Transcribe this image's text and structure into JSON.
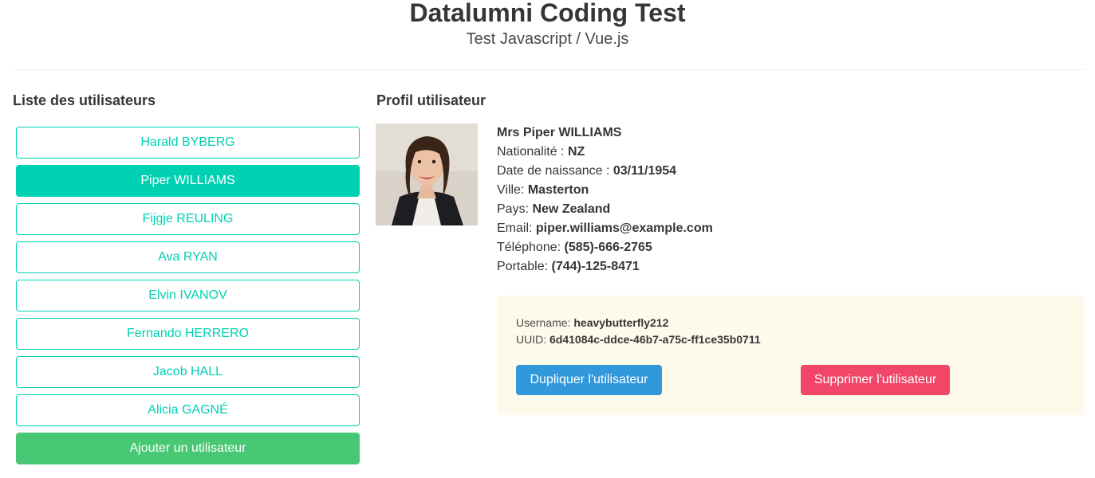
{
  "header": {
    "title": "Datalumni Coding Test",
    "subtitle": "Test Javascript / Vue.js"
  },
  "list": {
    "title": "Liste des utilisateurs",
    "users": [
      "Harald BYBERG",
      "Piper WILLIAMS",
      "Fijgje REULING",
      "Ava RYAN",
      "Elvin IVANOV",
      "Fernando HERRERO",
      "Jacob HALL",
      "Alicia GAGNÉ"
    ],
    "selected_user": "Piper WILLIAMS",
    "add_label": "Ajouter un utilisateur"
  },
  "profile": {
    "title": "Profil utilisateur",
    "full_name": "Mrs Piper WILLIAMS",
    "nationality_label": "Nationalité : ",
    "nationality": "NZ",
    "birthdate_label": "Date de naissance : ",
    "birthdate": "03/11/1954",
    "city_label": "Ville: ",
    "city": "Masterton",
    "country_label": "Pays: ",
    "country": "New Zealand",
    "email_label": "Email: ",
    "email": "piper.williams@example.com",
    "phone_label": "Téléphone: ",
    "phone": "(585)-666-2765",
    "mobile_label": "Portable: ",
    "mobile": "(744)-125-8471",
    "username_label": "Username: ",
    "username": "heavybutterfly212",
    "uuid_label": "UUID: ",
    "uuid": "6d41084c-ddce-46b7-a75c-ff1ce35b0711",
    "duplicate_label": "Dupliquer l'utilisateur",
    "delete_label": "Supprimer l'utilisateur"
  },
  "colors": {
    "primary": "#00d1b2",
    "success": "#48c774",
    "info": "#3298dc",
    "danger": "#f14668",
    "notice_bg": "#fefaeb"
  }
}
